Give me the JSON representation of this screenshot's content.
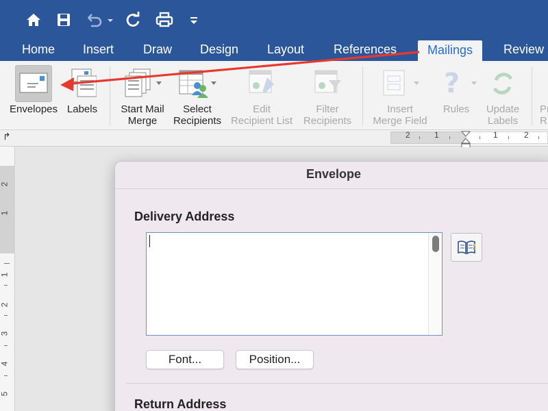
{
  "colors": {
    "word_blue": "#2b579a",
    "active_tab_text": "#2b6bd1",
    "arrow_red": "#e8392f"
  },
  "quick_access": {
    "icons": [
      "home-icon",
      "save-icon",
      "undo-icon",
      "redo-icon",
      "print-icon",
      "customize-icon"
    ]
  },
  "tabs": [
    {
      "label": "Home"
    },
    {
      "label": "Insert"
    },
    {
      "label": "Draw"
    },
    {
      "label": "Design"
    },
    {
      "label": "Layout"
    },
    {
      "label": "References"
    },
    {
      "label": "Mailings",
      "active": true
    },
    {
      "label": "Review"
    }
  ],
  "ribbon": {
    "envelopes": "Envelopes",
    "labels": "Labels",
    "start_mail_merge": [
      "Start Mail",
      "Merge"
    ],
    "select_recipients": [
      "Select",
      "Recipients"
    ],
    "edit_recipient_list": [
      "Edit",
      "Recipient List"
    ],
    "filter_recipients": [
      "Filter",
      "Recipients"
    ],
    "insert_merge_field": [
      "Insert",
      "Merge Field"
    ],
    "rules": "Rules",
    "update_labels": [
      "Update",
      "Labels"
    ],
    "preview_cut": [
      "Pr",
      "R"
    ]
  },
  "ruler": {
    "numbers": [
      "2",
      "1",
      "1",
      "2"
    ]
  },
  "vruler": {
    "numbers": [
      "2",
      "1",
      "1",
      "2",
      "3",
      "4",
      "5"
    ]
  },
  "dialog": {
    "title": "Envelope",
    "delivery_address_heading": "Delivery Address",
    "delivery_address_value": "",
    "font_button": "Font...",
    "position_button": "Position...",
    "return_address_heading": "Return Address"
  }
}
